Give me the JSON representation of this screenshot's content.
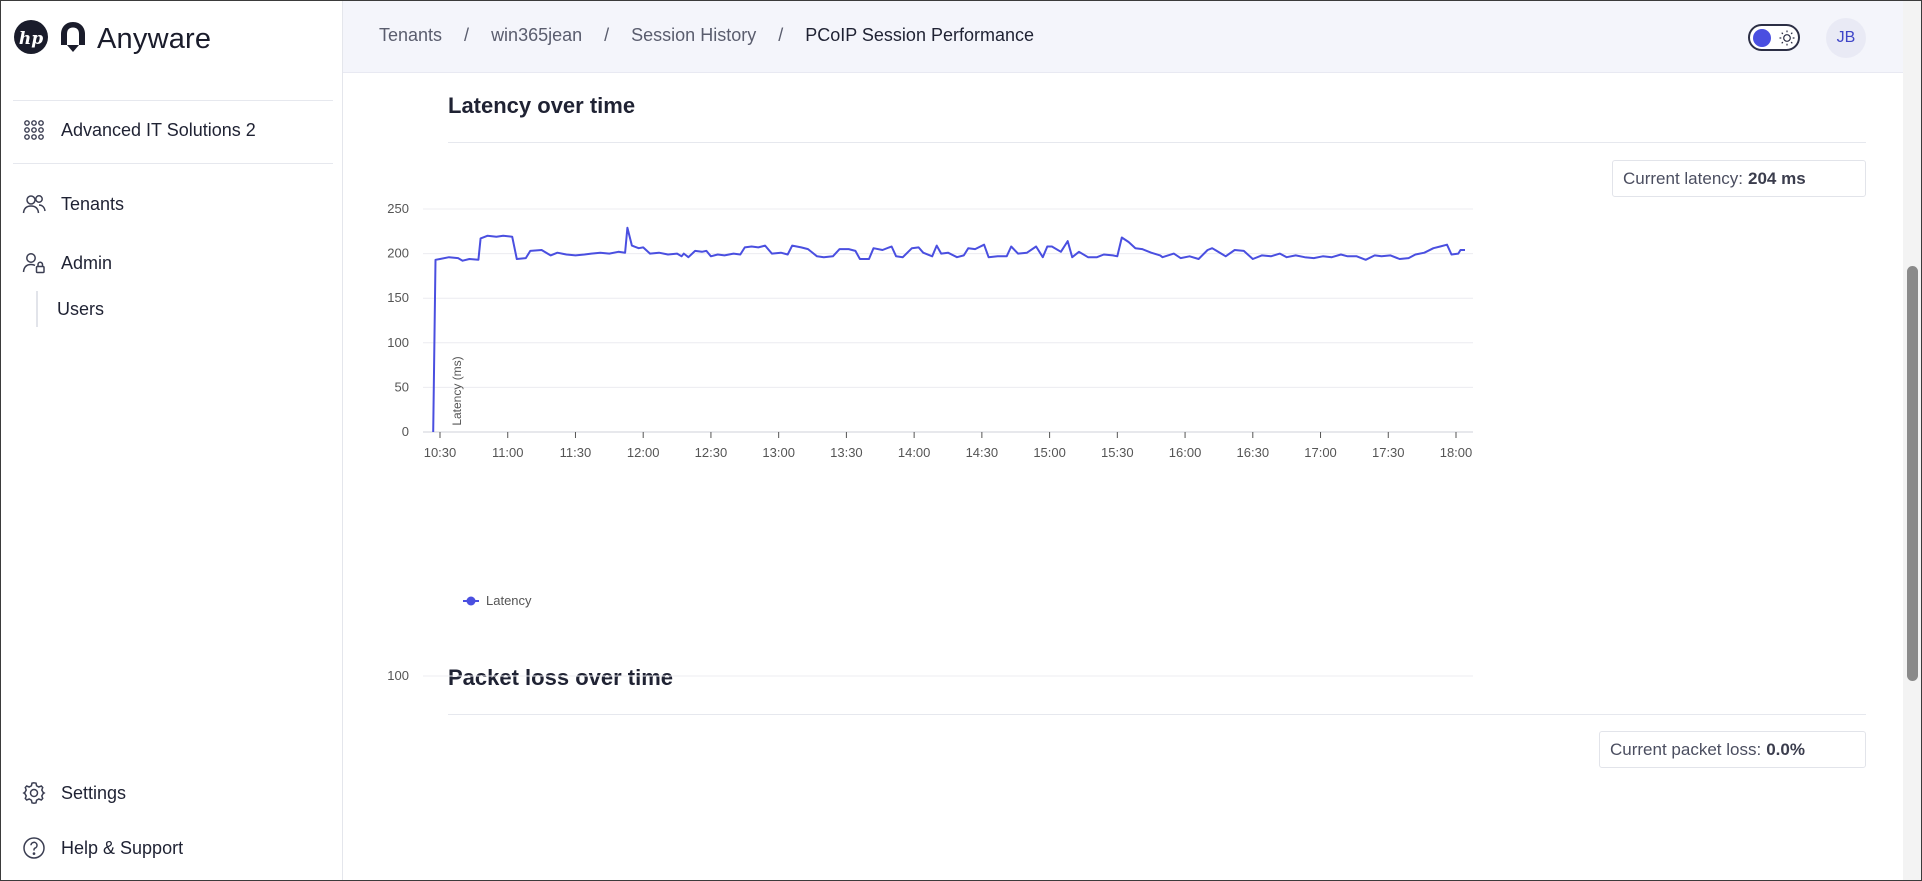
{
  "app": {
    "brand": "Anyware"
  },
  "sidebar": {
    "org": "Advanced IT Solutions 2",
    "tenants": "Tenants",
    "admin": "Admin",
    "users": "Users",
    "settings": "Settings",
    "help": "Help & Support"
  },
  "header": {
    "breadcrumb": [
      "Tenants",
      "win365jean",
      "Session History",
      "PCoIP Session Performance"
    ],
    "avatar_initials": "JB"
  },
  "latency": {
    "title": "Latency over time",
    "stat_label": "Current latency:",
    "stat_value": "204 ms"
  },
  "packet_loss": {
    "title": "Packet loss over time",
    "stat_label": "Current packet loss:",
    "stat_value": "0.0%"
  },
  "colors": {
    "accent": "#4a4fe0",
    "line": "#4a4fe0"
  },
  "chart_data": [
    {
      "type": "line",
      "ylabel": "Latency (ms)",
      "xlabel": "",
      "ylim": [
        0,
        250
      ],
      "yticks": [
        0,
        50,
        100,
        150,
        200,
        250
      ],
      "xticks": [
        "10:30",
        "11:00",
        "11:30",
        "12:00",
        "12:30",
        "13:00",
        "13:30",
        "14:00",
        "14:30",
        "15:00",
        "15:30",
        "16:00",
        "16:30",
        "17:00",
        "17:30",
        "18:00"
      ],
      "legend": "bottom-left",
      "series": [
        {
          "name": "Latency",
          "points": [
            [
              "10:27",
              0
            ],
            [
              "10:28",
              193
            ],
            [
              "10:30",
              194
            ],
            [
              "10:34",
              196
            ],
            [
              "10:38",
              195
            ],
            [
              "10:40",
              192
            ],
            [
              "10:43",
              194
            ],
            [
              "10:47",
              193
            ],
            [
              "10:48",
              217
            ],
            [
              "10:51",
              220
            ],
            [
              "10:55",
              219
            ],
            [
              "10:58",
              220
            ],
            [
              "11:02",
              219
            ],
            [
              "11:04",
              194
            ],
            [
              "11:08",
              195
            ],
            [
              "11:10",
              203
            ],
            [
              "11:15",
              204
            ],
            [
              "11:19",
              198
            ],
            [
              "11:22",
              201
            ],
            [
              "11:26",
              199
            ],
            [
              "11:30",
              198
            ],
            [
              "11:34",
              199
            ],
            [
              "11:37",
              200
            ],
            [
              "11:41",
              201
            ],
            [
              "11:45",
              200
            ],
            [
              "11:49",
              202
            ],
            [
              "11:52",
              201
            ],
            [
              "11:53",
              229
            ],
            [
              "11:55",
              209
            ],
            [
              "11:58",
              206
            ],
            [
              "12:00",
              207
            ],
            [
              "12:03",
              200
            ],
            [
              "12:07",
              201
            ],
            [
              "12:11",
              199
            ],
            [
              "12:15",
              200
            ],
            [
              "12:17",
              197
            ],
            [
              "12:18",
              200
            ],
            [
              "12:20",
              196
            ],
            [
              "12:23",
              203
            ],
            [
              "12:26",
              202
            ],
            [
              "12:28",
              203
            ],
            [
              "12:30",
              197
            ],
            [
              "12:33",
              199
            ],
            [
              "12:36",
              198
            ],
            [
              "12:40",
              200
            ],
            [
              "12:43",
              199
            ],
            [
              "12:45",
              207
            ],
            [
              "12:48",
              208
            ],
            [
              "12:51",
              207
            ],
            [
              "12:54",
              209
            ],
            [
              "12:57",
              200
            ],
            [
              "13:01",
              201
            ],
            [
              "13:04",
              199
            ],
            [
              "13:06",
              209
            ],
            [
              "13:10",
              207
            ],
            [
              "13:13",
              205
            ],
            [
              "13:17",
              197
            ],
            [
              "13:20",
              196
            ],
            [
              "13:24",
              197
            ],
            [
              "13:27",
              205
            ],
            [
              "13:31",
              205
            ],
            [
              "13:34",
              203
            ],
            [
              "13:36",
              194
            ],
            [
              "13:40",
              194
            ],
            [
              "13:42",
              206
            ],
            [
              "13:46",
              204
            ],
            [
              "13:50",
              208
            ],
            [
              "13:52",
              197
            ],
            [
              "13:55",
              196
            ],
            [
              "13:59",
              206
            ],
            [
              "14:02",
              207
            ],
            [
              "14:04",
              201
            ],
            [
              "14:08",
              197
            ],
            [
              "14:10",
              209
            ],
            [
              "14:12",
              200
            ],
            [
              "14:15",
              201
            ],
            [
              "14:19",
              196
            ],
            [
              "14:22",
              198
            ],
            [
              "14:24",
              206
            ],
            [
              "14:27",
              205
            ],
            [
              "14:31",
              210
            ],
            [
              "14:33",
              196
            ],
            [
              "14:37",
              197
            ],
            [
              "14:41",
              197
            ],
            [
              "14:43",
              208
            ],
            [
              "14:46",
              200
            ],
            [
              "14:50",
              201
            ],
            [
              "14:54",
              208
            ],
            [
              "14:57",
              196
            ],
            [
              "14:59",
              208
            ],
            [
              "15:01",
              208
            ],
            [
              "15:05",
              202
            ],
            [
              "15:08",
              214
            ],
            [
              "15:10",
              196
            ],
            [
              "15:13",
              202
            ],
            [
              "15:17",
              196
            ],
            [
              "15:21",
              196
            ],
            [
              "15:24",
              199
            ],
            [
              "15:28",
              198
            ],
            [
              "15:30",
              197
            ],
            [
              "15:32",
              218
            ],
            [
              "15:35",
              213
            ],
            [
              "15:38",
              206
            ],
            [
              "15:41",
              205
            ],
            [
              "15:45",
              201
            ],
            [
              "15:49",
              198
            ],
            [
              "15:50",
              196
            ],
            [
              "15:55",
              200
            ],
            [
              "15:58",
              195
            ],
            [
              "16:02",
              197
            ],
            [
              "16:06",
              194
            ],
            [
              "16:10",
              204
            ],
            [
              "16:12",
              206
            ],
            [
              "16:14",
              203
            ],
            [
              "16:18",
              197
            ],
            [
              "16:22",
              204
            ],
            [
              "16:26",
              203
            ],
            [
              "16:30",
              194
            ],
            [
              "16:34",
              198
            ],
            [
              "16:38",
              197
            ],
            [
              "16:42",
              200
            ],
            [
              "16:45",
              196
            ],
            [
              "16:49",
              198
            ],
            [
              "16:53",
              196
            ],
            [
              "16:57",
              195
            ],
            [
              "17:01",
              197
            ],
            [
              "17:05",
              196
            ],
            [
              "17:09",
              199
            ],
            [
              "17:12",
              197
            ],
            [
              "17:16",
              197
            ],
            [
              "17:20",
              193
            ],
            [
              "17:24",
              198
            ],
            [
              "17:27",
              197
            ],
            [
              "17:31",
              198
            ],
            [
              "17:35",
              194
            ],
            [
              "17:39",
              195
            ],
            [
              "17:42",
              199
            ],
            [
              "17:46",
              201
            ],
            [
              "17:50",
              206
            ],
            [
              "17:53",
              208
            ],
            [
              "17:56",
              210
            ],
            [
              "17:58",
              199
            ],
            [
              "18:01",
              200
            ],
            [
              "18:02",
              204
            ],
            [
              "18:04",
              204
            ]
          ]
        }
      ]
    },
    {
      "type": "line",
      "yticks": [
        100
      ],
      "series": []
    }
  ]
}
